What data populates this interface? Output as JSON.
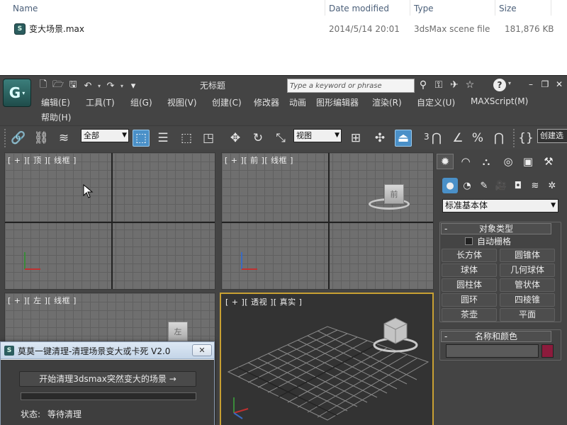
{
  "explorer": {
    "columns": {
      "name": "Name",
      "date_modified": "Date modified",
      "type": "Type",
      "size": "Size"
    },
    "file": {
      "name": "变大场景.max",
      "date_modified": "2014/5/14 20:01",
      "type": "3dsMax scene file",
      "size": "181,876 KB"
    }
  },
  "app": {
    "logo_glyph": "G",
    "title": "无标题",
    "search_placeholder": "Type a keyword or phrase",
    "help_glyph": "?",
    "menu": [
      "编辑(E)",
      "工具(T)",
      "组(G)",
      "视图(V)",
      "创建(C)",
      "修改器",
      "动画",
      "图形编辑器",
      "渲染(R)",
      "自定义(U)",
      "MAXScript(M)",
      "帮助(H)"
    ],
    "toolbar": {
      "selection_filter": "全部",
      "ref_coord": "视图",
      "snap_3": "3",
      "named_selection": "创建选"
    },
    "viewports": {
      "top": "[ + ][ 顶 ][ 线框 ]",
      "front": "[ + ][ 前 ][ 线框 ]",
      "left": "[ + ][ 左 ][ 线框 ]",
      "perspective": "[ + ][ 透视 ][ 真实 ]",
      "front_cube_label": "前",
      "left_cube_label": "左"
    },
    "command_panel": {
      "category": "标准基本体",
      "object_type_title": "对象类型",
      "autogrid_label": "自动栅格",
      "primitives": [
        "长方体",
        "圆锥体",
        "球体",
        "几何球体",
        "圆柱体",
        "管状体",
        "圆环",
        "四棱锥",
        "茶壶",
        "平面"
      ],
      "name_color_title": "名称和颜色",
      "object_color": "#8c1b3c",
      "rollout_toggle": "-"
    }
  },
  "dialog": {
    "title": "莫莫一键清理-清理场景变大或卡死 V2.0",
    "close_glyph": "✕",
    "button_label": "开始清理3dsmax突然变大的场景 →",
    "progress": 0,
    "status_label": "状态:",
    "status_value": "等待清理"
  }
}
